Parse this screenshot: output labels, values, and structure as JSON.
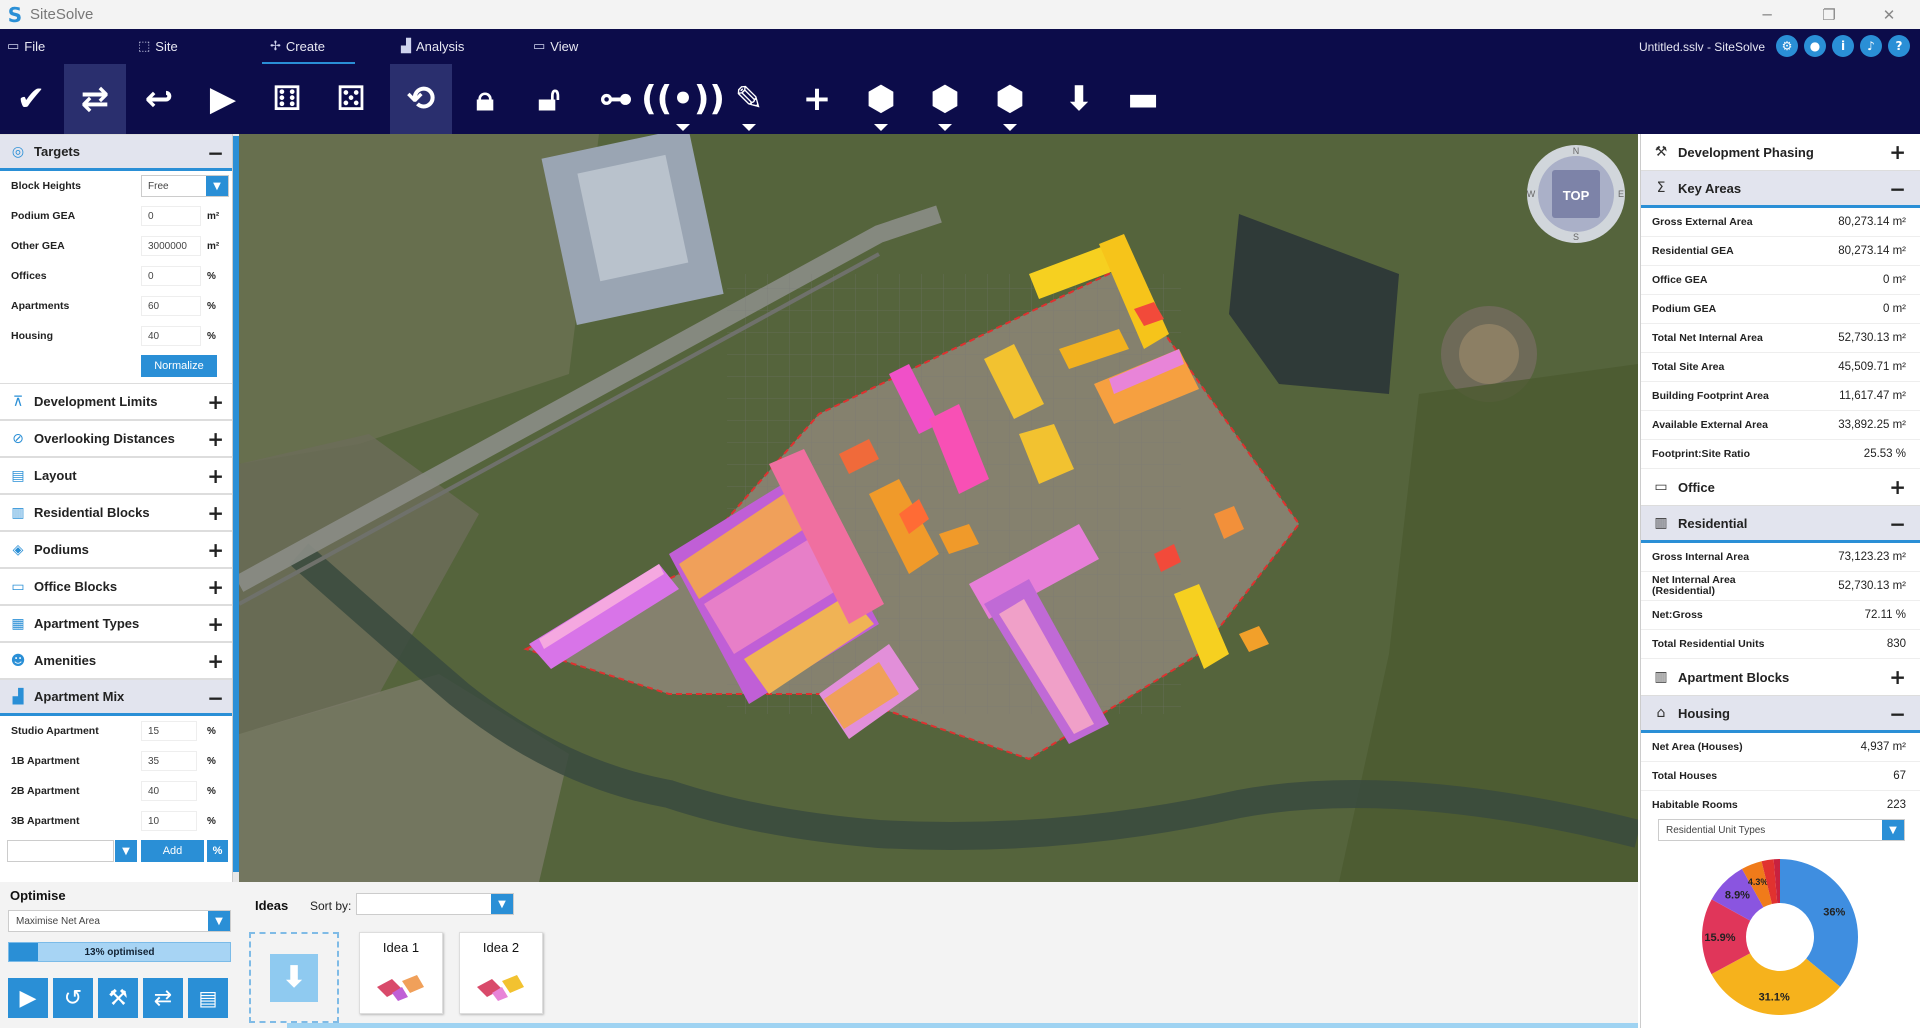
{
  "window": {
    "app_name": "SiteSolve",
    "minimize": "─",
    "restore": "❐",
    "close": "✕"
  },
  "menu": {
    "items": [
      {
        "label": "File",
        "icon": "file-icon"
      },
      {
        "label": "Site",
        "icon": "site-icon"
      },
      {
        "label": "Create",
        "icon": "create-icon"
      },
      {
        "label": "Analysis",
        "icon": "analysis-icon"
      },
      {
        "label": "View",
        "icon": "view-icon"
      }
    ],
    "active": "Create",
    "document_title": "Untitled.sslv - SiteSolve"
  },
  "toolbar": {
    "buttons": [
      "check-icon",
      "toggle-generate-icon",
      "undo-icon",
      "play-icon",
      "dice-icon",
      "random-dice-icon",
      "refresh-lock-icon",
      "lock-icon",
      "unlock-icon",
      "network-icon",
      "broadcast-icon",
      "edit-block-icon",
      "add-icon",
      "cube-edit-icon",
      "cube-draw-icon",
      "cube-erase-icon",
      "download-icon",
      "remove-icon"
    ]
  },
  "targets": {
    "title": "Targets",
    "rows": [
      {
        "label": "Block Heights",
        "value": "Free",
        "unit": ""
      },
      {
        "label": "Podium GEA",
        "value": "0",
        "unit": "m²"
      },
      {
        "label": "Other GEA",
        "value": "3000000",
        "unit": "m²"
      },
      {
        "label": "Offices",
        "value": "0",
        "unit": "%"
      },
      {
        "label": "Apartments",
        "value": "60",
        "unit": "%"
      },
      {
        "label": "Housing",
        "value": "40",
        "unit": "%"
      }
    ],
    "normalize": "Normalize"
  },
  "left_sections": [
    "Development Limits",
    "Overlooking Distances",
    "Layout",
    "Residential Blocks",
    "Podiums",
    "Office Blocks",
    "Apartment Types",
    "Amenities"
  ],
  "apartment_mix": {
    "title": "Apartment Mix",
    "rows": [
      {
        "label": "Studio Apartment",
        "value": "15",
        "unit": "%"
      },
      {
        "label": "1B Apartment",
        "value": "35",
        "unit": "%"
      },
      {
        "label": "2B Apartment",
        "value": "40",
        "unit": "%"
      },
      {
        "label": "3B Apartment",
        "value": "10",
        "unit": "%"
      }
    ],
    "add": "Add",
    "pct": "%"
  },
  "optimise": {
    "title": "Optimise",
    "mode": "Maximise Net Area",
    "progress_text": "13% optimised",
    "progress": 0.13
  },
  "compass": {
    "n": "N",
    "s": "S",
    "e": "E",
    "w": "W",
    "top": "TOP"
  },
  "ideas": {
    "title": "Ideas",
    "sort_label": "Sort by:",
    "sort_value": "",
    "cards": [
      {
        "name": "Idea 1"
      },
      {
        "name": "Idea 2"
      }
    ]
  },
  "right": {
    "development_phasing": "Development Phasing",
    "key_areas": {
      "title": "Key Areas",
      "rows": [
        {
          "label": "Gross External Area",
          "value": "80,273.14 m²"
        },
        {
          "label": "Residential GEA",
          "value": "80,273.14 m²"
        },
        {
          "label": "Office GEA",
          "value": "0 m²"
        },
        {
          "label": "Podium GEA",
          "value": "0 m²"
        },
        {
          "label": "Total Net Internal Area",
          "value": "52,730.13 m²"
        },
        {
          "label": "Total Site Area",
          "value": "45,509.71 m²"
        },
        {
          "label": "Building Footprint Area",
          "value": "11,617.47 m²"
        },
        {
          "label": "Available External Area",
          "value": "33,892.25 m²"
        },
        {
          "label": "Footprint:Site Ratio",
          "value": "25.53 %"
        }
      ]
    },
    "office": "Office",
    "residential": {
      "title": "Residential",
      "rows": [
        {
          "label": "Gross Internal Area",
          "value": "73,123.23 m²"
        },
        {
          "label": "Net Internal Area (Residential)",
          "value": "52,730.13 m²"
        },
        {
          "label": "Net:Gross",
          "value": "72.11 %"
        },
        {
          "label": "Total Residential Units",
          "value": "830"
        }
      ]
    },
    "apartment_blocks": "Apartment Blocks",
    "housing": {
      "title": "Housing",
      "rows": [
        {
          "label": "Net Area (Houses)",
          "value": "4,937 m²"
        },
        {
          "label": "Total Houses",
          "value": "67"
        },
        {
          "label": "Habitable Rooms",
          "value": "223"
        }
      ]
    }
  },
  "chart_selector": "Residential Unit Types",
  "chart_data": {
    "type": "pie",
    "donut": true,
    "slices": [
      {
        "label": "36%",
        "value": 36,
        "color": "#3f8ee0"
      },
      {
        "label": "31.1%",
        "value": 31.1,
        "color": "#f6b21c"
      },
      {
        "label": "15.9%",
        "value": 15.9,
        "color": "#e0365a"
      },
      {
        "label": "8.9%",
        "value": 8.9,
        "color": "#8a55e0"
      },
      {
        "label": "4.3%",
        "value": 4.3,
        "color": "#f07b1a"
      },
      {
        "label": "",
        "value": 2.5,
        "color": "#e1322f"
      },
      {
        "label": "",
        "value": 1.3,
        "color": "#c8213f"
      }
    ]
  }
}
